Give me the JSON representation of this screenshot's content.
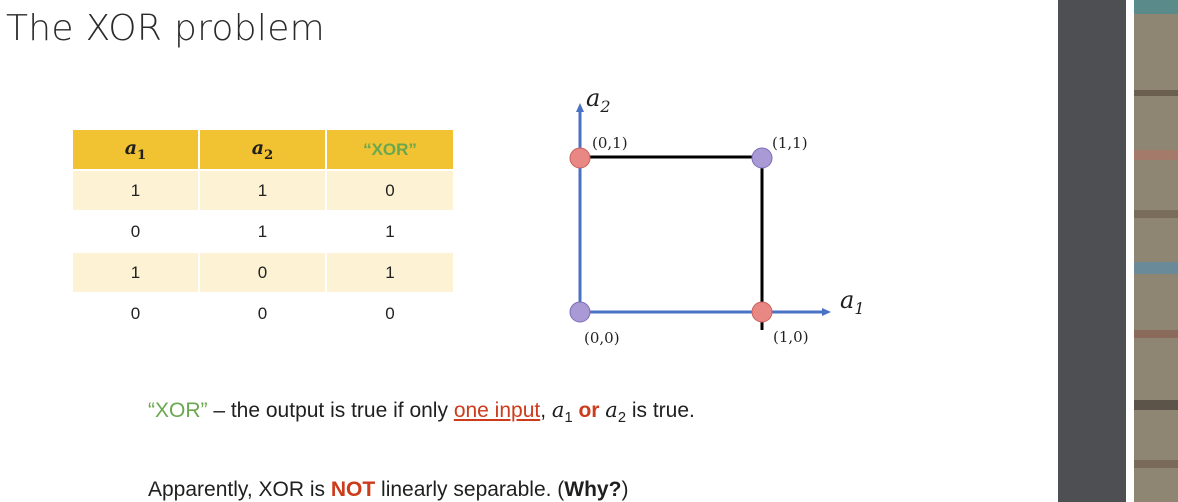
{
  "slide": {
    "title": "The XOR problem",
    "table": {
      "headers": [
        "a",
        "a",
        "“XOR”"
      ],
      "header_subs": [
        "1",
        "2"
      ],
      "rows": [
        [
          "1",
          "1",
          "0"
        ],
        [
          "0",
          "1",
          "1"
        ],
        [
          "1",
          "0",
          "1"
        ],
        [
          "0",
          "0",
          "0"
        ]
      ]
    },
    "diagram": {
      "x_axis_label": "a",
      "x_axis_sub": "1",
      "y_axis_label": "a",
      "y_axis_sub": "2",
      "points": [
        {
          "label": "(0,0)",
          "class": "blue"
        },
        {
          "label": "(0,1)",
          "class": "red"
        },
        {
          "label": "(1,0)",
          "class": "red"
        },
        {
          "label": "(1,1)",
          "class": "blue"
        }
      ],
      "colors": {
        "axis": "#4a72c4",
        "red_point": "#e88784",
        "blue_point": "#a99ad6",
        "line": "#000000"
      }
    },
    "description": {
      "part1": "“XOR”",
      "part2": " – the output is true if only ",
      "one_input": "one input",
      "part3": ", ",
      "var1": "a",
      "sub1": "1",
      "or_word": "or",
      "var2": "a",
      "sub2": "2",
      "part4": " is true."
    },
    "conclusion": {
      "part1": "Apparently, XOR is ",
      "not_word": "NOT",
      "part2": " linearly separable. (",
      "why": "Why?",
      "part3": ")"
    }
  },
  "colors": {
    "header_bg": "#f1c232",
    "row_alt": "#fdf2d4",
    "xor_green": "#6aa84f",
    "accent_red": "#cc3b1b",
    "side_panel": "#4d4f52"
  }
}
